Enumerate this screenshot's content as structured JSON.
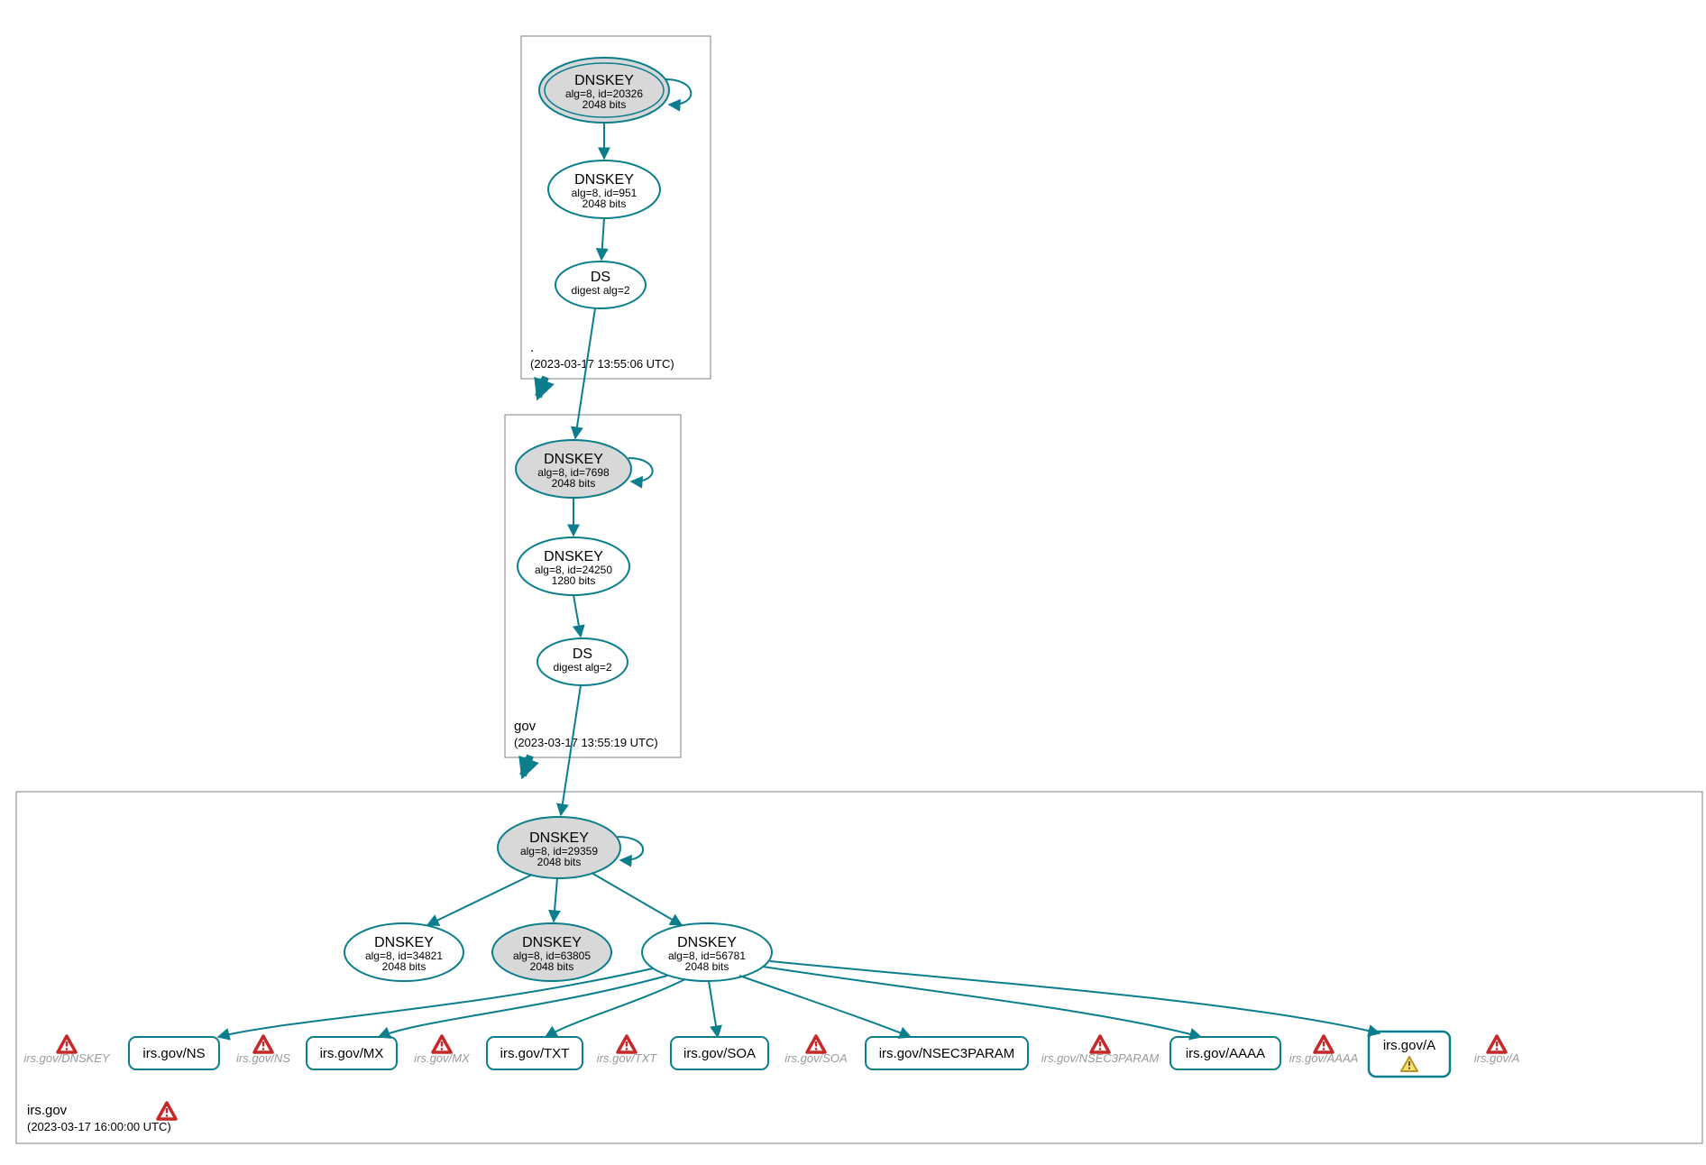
{
  "colors": {
    "accent": "#0a7e8c",
    "warn_red": "#c62828",
    "warn_yellow": "#f4d03f"
  },
  "zones": {
    "root": {
      "name": ".",
      "ts": "(2023-03-17 13:55:06 UTC)"
    },
    "gov": {
      "name": "gov",
      "ts": "(2023-03-17 13:55:19 UTC)"
    },
    "irsgov": {
      "name": "irs.gov",
      "ts": "(2023-03-17 16:00:00 UTC)"
    }
  },
  "root": {
    "ksk": {
      "t": "DNSKEY",
      "l1": "alg=8, id=20326",
      "l2": "2048 bits"
    },
    "zsk": {
      "t": "DNSKEY",
      "l1": "alg=8, id=951",
      "l2": "2048 bits"
    },
    "ds": {
      "t": "DS",
      "l1": "digest alg=2"
    }
  },
  "gov": {
    "ksk": {
      "t": "DNSKEY",
      "l1": "alg=8, id=7698",
      "l2": "2048 bits"
    },
    "zsk": {
      "t": "DNSKEY",
      "l1": "alg=8, id=24250",
      "l2": "1280 bits"
    },
    "ds": {
      "t": "DS",
      "l1": "digest alg=2"
    }
  },
  "irs": {
    "ksk": {
      "t": "DNSKEY",
      "l1": "alg=8, id=29359",
      "l2": "2048 bits"
    },
    "k34821": {
      "t": "DNSKEY",
      "l1": "alg=8, id=34821",
      "l2": "2048 bits"
    },
    "k63805": {
      "t": "DNSKEY",
      "l1": "alg=8, id=63805",
      "l2": "2048 bits"
    },
    "k56781": {
      "t": "DNSKEY",
      "l1": "alg=8, id=56781",
      "l2": "2048 bits"
    }
  },
  "rr": {
    "ns": "irs.gov/NS",
    "mx": "irs.gov/MX",
    "txt": "irs.gov/TXT",
    "soa": "irs.gov/SOA",
    "nsec": "irs.gov/NSEC3PARAM",
    "aaaa": "irs.gov/AAAA",
    "a": "irs.gov/A"
  },
  "ghost": {
    "dnskey": "irs.gov/DNSKEY",
    "ns": "irs.gov/NS",
    "mx": "irs.gov/MX",
    "txt": "irs.gov/TXT",
    "soa": "irs.gov/SOA",
    "nsec": "irs.gov/NSEC3PARAM",
    "aaaa": "irs.gov/AAAA",
    "a": "irs.gov/A"
  }
}
